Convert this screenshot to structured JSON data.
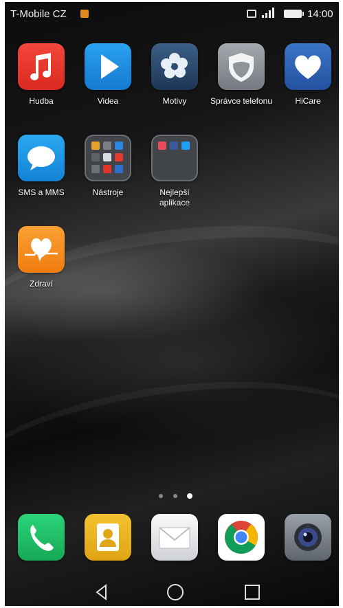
{
  "status_bar": {
    "carrier": "T-Mobile CZ",
    "time": "14:00",
    "sim_color": "#e08a1e",
    "icons": [
      "sim-notification-icon",
      "nfc-icon",
      "signal-icon",
      "battery-icon"
    ]
  },
  "apps": [
    {
      "label": "Hudba",
      "icon": "music-icon",
      "color": "#e8352b"
    },
    {
      "label": "Videa",
      "icon": "play-icon",
      "color": "#1b8fe0"
    },
    {
      "label": "Motivy",
      "icon": "themes-flower-icon",
      "color": "#2e4c6e"
    },
    {
      "label": "Správce telefonu",
      "icon": "shield-icon",
      "color": "#8e9499"
    },
    {
      "label": "HiCare",
      "icon": "heart-icon",
      "color": "#2f66b5"
    },
    {
      "label": "SMS a MMS",
      "icon": "message-bubble-icon",
      "color": "#1d9be6"
    },
    {
      "label": "Nástroje",
      "icon": "folder-icon",
      "color": "#3b3e44"
    },
    {
      "label": "Nejlepší aplikace",
      "icon": "folder-icon",
      "color": "#3b3e44"
    },
    {
      "label": "Zdraví",
      "icon": "health-heart-icon",
      "color": "#f5901f"
    }
  ],
  "page_indicator": {
    "count": 3,
    "active": 3
  },
  "dock": [
    {
      "name": "phone",
      "icon": "phone-icon",
      "color": "#1fbf62"
    },
    {
      "name": "contacts",
      "icon": "contact-icon",
      "color": "#eab21b"
    },
    {
      "name": "email",
      "icon": "envelope-icon",
      "color": "#e6e6e6"
    },
    {
      "name": "chrome",
      "icon": "chrome-icon",
      "color": "#ffffff"
    },
    {
      "name": "camera",
      "icon": "camera-icon",
      "color": "#7a8089"
    }
  ],
  "nav_bar": {
    "buttons": [
      "back-icon",
      "home-icon",
      "recents-icon"
    ]
  }
}
